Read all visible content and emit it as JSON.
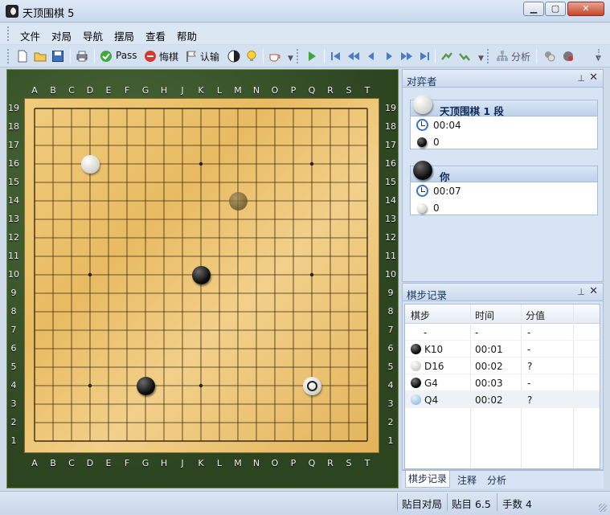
{
  "window": {
    "title": "天顶围棋 5"
  },
  "menu": [
    "文件",
    "对局",
    "导航",
    "摆局",
    "查看",
    "帮助"
  ],
  "toolbar": {
    "pass_label": "Pass",
    "undo_label": "悔棋",
    "resign_label": "认输",
    "analysis_label": "分析"
  },
  "board": {
    "size": 19,
    "columns": [
      "A",
      "B",
      "C",
      "D",
      "E",
      "F",
      "G",
      "H",
      "J",
      "K",
      "L",
      "M",
      "N",
      "O",
      "P",
      "Q",
      "R",
      "S",
      "T"
    ],
    "rows": [
      "19",
      "18",
      "17",
      "16",
      "15",
      "14",
      "13",
      "12",
      "11",
      "10",
      "9",
      "8",
      "7",
      "6",
      "5",
      "4",
      "3",
      "2",
      "1"
    ],
    "stones": [
      {
        "point": "D16",
        "color": "white"
      },
      {
        "point": "K10",
        "color": "black"
      },
      {
        "point": "G4",
        "color": "black"
      },
      {
        "point": "Q4",
        "color": "white",
        "last_move": true
      },
      {
        "point": "M14",
        "color": "ghost"
      }
    ]
  },
  "players_panel": {
    "title": "对弈者",
    "players": [
      {
        "name": "天顶围棋 1 段",
        "stone": "white",
        "time": "00:04",
        "captures": "0"
      },
      {
        "name": "你",
        "stone": "black",
        "time": "00:07",
        "captures": "0"
      }
    ]
  },
  "moves_panel": {
    "title": "棋步记录",
    "columns": [
      "棋步",
      "时间",
      "分值"
    ],
    "rows": [
      {
        "move": "-",
        "time": "-",
        "score": "-",
        "stone": ""
      },
      {
        "move": "K10",
        "time": "00:01",
        "score": "-",
        "stone": "black"
      },
      {
        "move": "D16",
        "time": "00:02",
        "score": "?",
        "stone": "white"
      },
      {
        "move": "G4",
        "time": "00:03",
        "score": "-",
        "stone": "black"
      },
      {
        "move": "Q4",
        "time": "00:02",
        "score": "?",
        "stone": "white-selected"
      }
    ]
  },
  "tabs": [
    "棋步记录",
    "注释",
    "分析"
  ],
  "status": {
    "mode": "贴目对局",
    "komi": "贴目 6.5",
    "move_count": "手数 4"
  },
  "colors": {
    "board": "#eec372",
    "felt": "#3a5a2a",
    "accent": "#1e5fb3"
  }
}
